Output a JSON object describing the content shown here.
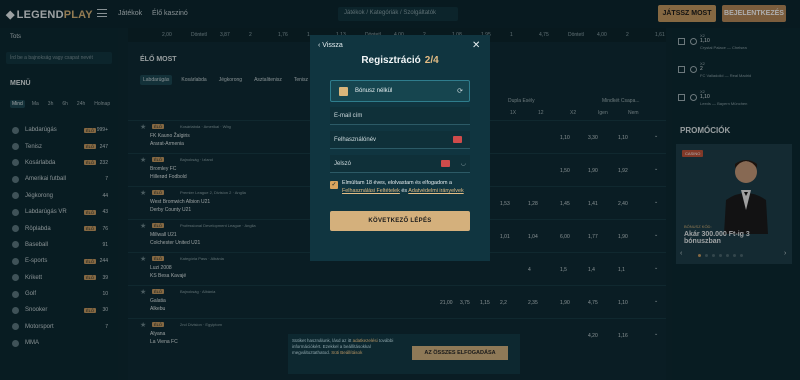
{
  "topbar": {
    "logo_a": "LEGEND",
    "logo_b": "PLAY",
    "nav": [
      "Játékok",
      "Élő kaszinó"
    ],
    "search_placeholder": "Játékok / Kategóriák / Szolgáltatók",
    "play_now": "JÁTSSZ MOST",
    "login": "BEJELENTKEZÉS"
  },
  "sidebar": {
    "tab": "Tots",
    "search_placeholder": "Írd be a bajnokság vagy csapat nevét",
    "menu_title": "MENÜ",
    "filters": [
      "Mind",
      "Ma",
      "3h",
      "6h",
      "24h",
      "Holnap"
    ],
    "live_label": "ÉLŐ",
    "items": [
      {
        "label": "Labdarúgás",
        "count": "999+",
        "live": true
      },
      {
        "label": "Tenisz",
        "count": "247",
        "live": true
      },
      {
        "label": "Kosárlabda",
        "count": "232",
        "live": true
      },
      {
        "label": "Amerikai futball",
        "count": "7",
        "live": false
      },
      {
        "label": "Jégkorong",
        "count": "44",
        "live": false
      },
      {
        "label": "Labdarúgás VR",
        "count": "43",
        "live": true
      },
      {
        "label": "Röplabda",
        "count": "76",
        "live": true
      },
      {
        "label": "Baseball",
        "count": "91",
        "live": false
      },
      {
        "label": "E-sports",
        "count": "244",
        "live": true
      },
      {
        "label": "Krikett",
        "count": "39",
        "live": true
      },
      {
        "label": "Golf",
        "count": "10",
        "live": false
      },
      {
        "label": "Snooker",
        "count": "30",
        "live": true
      },
      {
        "label": "Motorsport",
        "count": "7",
        "live": false
      },
      {
        "label": "MMA",
        "count": "",
        "live": false
      }
    ]
  },
  "main": {
    "top_strip": [
      "2,00",
      "Döntetl",
      "3,87",
      "2",
      "1,76",
      "1",
      "1,13",
      "Döntetl",
      "4,00",
      "2",
      "1,08",
      "1,95",
      "1",
      "4,75",
      "Döntetl",
      "4,00",
      "2",
      "1,61"
    ],
    "section_title": "ÉLŐ MOST",
    "tabs": [
      "Labdarúgás",
      "Kosárlabda",
      "Jégkorong",
      "Asztalitenisz",
      "Tenisz"
    ],
    "col_heads": [
      "Dupla Esély",
      "Mindkét Csapa..."
    ],
    "col_subs": [
      "1X",
      "12",
      "X2",
      "Igen",
      "Nem"
    ],
    "matches": [
      {
        "star": "★",
        "live": "ÉLŐ",
        "league": "Kosárlabda · Amerikai · Wbg",
        "t1": "FK Kauno Žalgiris",
        "t2": "Ararat-Armenia",
        "odds": [
          "1,10",
          "3,30",
          "1,10"
        ]
      },
      {
        "star": "★",
        "live": "ÉLŐ",
        "league": "Bajnokság · Izland",
        "t1": "Bromley FC",
        "t2": "Hillerød Fodbold",
        "odds": [
          "1,50",
          "1,90",
          "1,92"
        ]
      },
      {
        "star": "★",
        "live": "ÉLŐ",
        "league": "Premier League 2, Division 2 · Anglia",
        "t1": "West Bromwich Albion U21",
        "t2": "Derby County U21",
        "odds": [
          "1,53",
          "1,28",
          "1,45",
          "1,41",
          "2,40"
        ]
      },
      {
        "star": "★",
        "live": "ÉLŐ",
        "league": "Professional Development League · Anglia",
        "t1": "Millwall U21",
        "t2": "Colchester United U21",
        "odds": [
          "1,01",
          "1,04",
          "6,00",
          "1,77",
          "1,90"
        ]
      },
      {
        "star": "★",
        "live": "ÉLŐ",
        "league": "Kategória Pass · Albánia",
        "t1": "Luzi 2008",
        "t2": "KS Besa Kavajë",
        "odds": [
          "4",
          "1,5",
          "1,4",
          "1,1"
        ]
      },
      {
        "star": "★",
        "live": "ÉLŐ",
        "league": "Bajnokság · Albánia",
        "t1": "Galatia",
        "t2": "Alkebu",
        "odds": [
          "21,00",
          "3,75",
          "1,15",
          "2,2",
          "2,35",
          "1,90",
          "4,75",
          "1,10"
        ]
      },
      {
        "star": "★",
        "live": "ÉLŐ",
        "league": "2nd Division · Egyiptom",
        "t1": "Alyana",
        "t2": "La Viena FC",
        "odds": [
          "4,20",
          "1,16"
        ]
      }
    ]
  },
  "right": {
    "bets": [
      {
        "odd": "X2",
        "val": "1,10",
        "match": "Crystal Palace — Chelsea"
      },
      {
        "odd": "X2",
        "val": "2",
        "match": "FC Valladolid — Real Madrid"
      },
      {
        "odd": "X2",
        "val": "1,10",
        "match": "Leeds — Bayern München"
      }
    ],
    "promo_title": "PROMÓCIÓK",
    "promo_badge": "CASINO",
    "promo_sub": "BÓNUSZ KÓD:",
    "promo_head": "Akár 300.000 Ft-ig 3 bónuszban"
  },
  "modal": {
    "back": "Vissza",
    "title": "Regisztráció",
    "step": "2/4",
    "bonus": "Bónusz nélkül",
    "email_placeholder": "E-mail cím",
    "username_placeholder": "Felhasználónév",
    "password_placeholder": "Jelszó",
    "consent_pre": "Elmúltam 18 éves, elolvastam és elfogadom a",
    "consent_link1": "Felhasználási Feltételek",
    "consent_mid": "és",
    "consent_link2": "Adatvédelmi irányelvek",
    "next": "KÖVETKEZŐ LÉPÉS"
  },
  "cookie": {
    "text": "Sütiket használunk, lásd az itt",
    "link1": "adatkezelési",
    "text2": "további információkért. Ezekkel a beállításokkal megváltoztathatod.",
    "link2": "Süti Beállítások",
    "accept": "AZ ÖSSZES ELFOGADÁSA"
  },
  "colors": {
    "accent": "#c59a62",
    "bg": "#0e2a33",
    "modal": "#103540",
    "step": "#e3bc84"
  }
}
